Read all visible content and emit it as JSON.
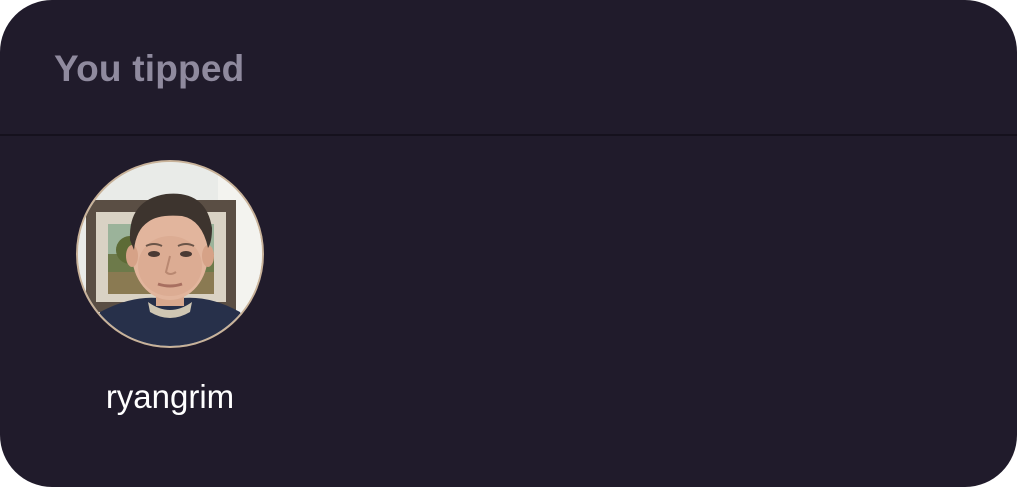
{
  "panel": {
    "title": "You tipped"
  },
  "recipients": [
    {
      "username": "ryangrim",
      "avatar_icon": "user-photo-avatar"
    }
  ],
  "colors": {
    "card_background": "#201b2b",
    "title_text": "#8f8a9e",
    "username_text": "#ffffff",
    "divider": "#15111d"
  }
}
